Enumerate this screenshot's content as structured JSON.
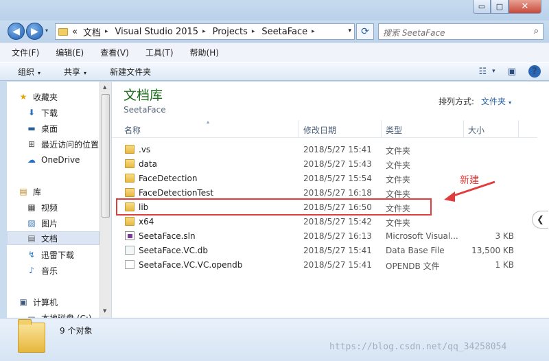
{
  "window": {
    "minimize": "▭",
    "maximize": "□",
    "close": "✕"
  },
  "nav": {
    "back": "◀",
    "forward": "▶",
    "recent": "▾"
  },
  "address": {
    "chevron": "«",
    "segments": [
      "文档",
      "Visual Studio 2015",
      "Projects",
      "SeetaFace"
    ],
    "separator": "▸",
    "dropdown": "▾",
    "refresh": "⟳"
  },
  "search": {
    "placeholder": "搜索 SeetaFace",
    "icon": "⌕"
  },
  "menu": [
    "文件(F)",
    "编辑(E)",
    "查看(V)",
    "工具(T)",
    "帮助(H)"
  ],
  "toolbar": {
    "organize": "组织",
    "share": "共享",
    "new_folder": "新建文件夹",
    "caret": "▾",
    "views_glyph": "☷",
    "views_caret": "▾",
    "pane_glyph": "▣",
    "help": "?"
  },
  "navpane": {
    "items": [
      {
        "label": "收藏夹",
        "icon": "★"
      },
      {
        "label": "下载",
        "icon": "⬇"
      },
      {
        "label": "桌面",
        "icon": "▬"
      },
      {
        "label": "最近访问的位置",
        "icon": "⊞"
      },
      {
        "label": "OneDrive",
        "icon": "☁"
      },
      {
        "label": "库",
        "icon": "▤"
      },
      {
        "label": "视频",
        "icon": "▦"
      },
      {
        "label": "图片",
        "icon": "▨"
      },
      {
        "label": "文档",
        "icon": "▤"
      },
      {
        "label": "迅雷下载",
        "icon": "↯"
      },
      {
        "label": "音乐",
        "icon": "♪"
      },
      {
        "label": "计算机",
        "icon": "▣"
      },
      {
        "label": "本地磁盘 (C:)",
        "icon": "▭"
      }
    ],
    "scroll_up": "▲",
    "scroll_down": "▼"
  },
  "library": {
    "title": "文档库",
    "subtitle": "SeetaFace",
    "arrange_label": "排列方式:",
    "arrange_value": "文件夹",
    "arrange_caret": "▾"
  },
  "columns": {
    "name": "名称",
    "date": "修改日期",
    "type": "类型",
    "size": "大小",
    "sort_caret": "▴"
  },
  "files": [
    {
      "name": ".vs",
      "date": "2018/5/27 15:41",
      "type": "文件夹",
      "size": "",
      "icon": "folder"
    },
    {
      "name": "data",
      "date": "2018/5/27 15:43",
      "type": "文件夹",
      "size": "",
      "icon": "folder"
    },
    {
      "name": "FaceDetection",
      "date": "2018/5/27 15:54",
      "type": "文件夹",
      "size": "",
      "icon": "folder"
    },
    {
      "name": "FaceDetectionTest",
      "date": "2018/5/27 16:18",
      "type": "文件夹",
      "size": "",
      "icon": "folder"
    },
    {
      "name": "lib",
      "date": "2018/5/27 16:50",
      "type": "文件夹",
      "size": "",
      "icon": "folder"
    },
    {
      "name": "x64",
      "date": "2018/5/27 15:42",
      "type": "文件夹",
      "size": "",
      "icon": "folder"
    },
    {
      "name": "SeetaFace.sln",
      "date": "2018/5/27 16:13",
      "type": "Microsoft Visual...",
      "size": "3 KB",
      "icon": "sln"
    },
    {
      "name": "SeetaFace.VC.db",
      "date": "2018/5/27 15:41",
      "type": "Data Base File",
      "size": "13,500 KB",
      "icon": "db"
    },
    {
      "name": "SeetaFace.VC.VC.opendb",
      "date": "2018/5/27 15:41",
      "type": "OPENDB 文件",
      "size": "1 KB",
      "icon": "blank"
    }
  ],
  "annotation": {
    "label": "新建"
  },
  "collapse": "❮",
  "details": {
    "count": "9 个对象"
  },
  "watermark": "https://blog.csdn.net/qq_34258054",
  "colors": {
    "annotation": "#e23b3b",
    "library_title": "#1e6e1e",
    "accent": "#1e5aa0"
  }
}
